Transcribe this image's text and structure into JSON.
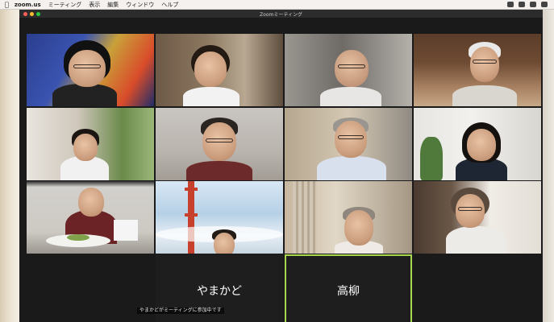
{
  "menubar": {
    "app_name": "zoom.us",
    "items": [
      "ミーティング",
      "表示",
      "編集",
      "ウィンドウ",
      "ヘルプ"
    ]
  },
  "window": {
    "title": "Zoomミーティング"
  },
  "tiles": {
    "name_1": "やまかど",
    "name_2": "高柳"
  },
  "caption": "やまかどがミーティングに参加中です",
  "colors": {
    "active_speaker_border": "#a8d84e",
    "window_bg": "#1a1a1a",
    "tile_empty_bg": "#1e1e1e"
  }
}
